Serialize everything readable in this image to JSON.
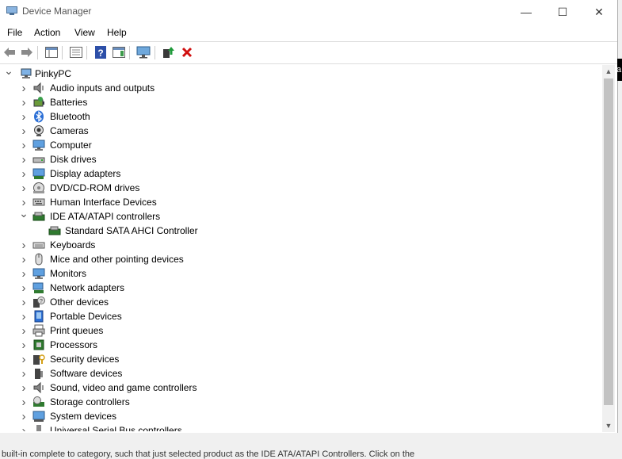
{
  "window": {
    "title": "Device Manager",
    "minimize_glyph": "—",
    "maximize_glyph": "☐",
    "close_glyph": "✕"
  },
  "menu": [
    "File",
    "Action",
    "View",
    "Help"
  ],
  "toolbar": [
    {
      "icon": "back-arrow-icon"
    },
    {
      "icon": "forward-arrow-icon"
    },
    {
      "icon": "show-hide-console-tree-icon"
    },
    {
      "icon": "properties-icon"
    },
    {
      "icon": "help-icon"
    },
    {
      "icon": "action-pane-icon"
    },
    {
      "icon": "scan-hardware-changes-icon"
    },
    {
      "icon": "update-driver-icon"
    },
    {
      "icon": "uninstall-device-icon"
    }
  ],
  "tree": {
    "root": {
      "label": "PinkyPC",
      "icon": "computer-icon",
      "expanded": true
    },
    "items": [
      {
        "label": "Audio inputs and outputs",
        "icon": "speaker-icon",
        "expanded": false
      },
      {
        "label": "Batteries",
        "icon": "battery-icon",
        "expanded": false
      },
      {
        "label": "Bluetooth",
        "icon": "bluetooth-icon",
        "expanded": false
      },
      {
        "label": "Cameras",
        "icon": "camera-icon",
        "expanded": false
      },
      {
        "label": "Computer",
        "icon": "monitor-icon",
        "expanded": false
      },
      {
        "label": "Disk drives",
        "icon": "disk-drive-icon",
        "expanded": false
      },
      {
        "label": "Display adapters",
        "icon": "display-adapter-icon",
        "expanded": false
      },
      {
        "label": "DVD/CD-ROM drives",
        "icon": "dvd-drive-icon",
        "expanded": false
      },
      {
        "label": "Human Interface Devices",
        "icon": "hid-icon",
        "expanded": false
      },
      {
        "label": "IDE ATA/ATAPI controllers",
        "icon": "ide-controller-icon",
        "expanded": true,
        "children": [
          {
            "label": "Standard SATA AHCI Controller",
            "icon": "ide-controller-icon"
          }
        ]
      },
      {
        "label": "Keyboards",
        "icon": "keyboard-icon",
        "expanded": false
      },
      {
        "label": "Mice and other pointing devices",
        "icon": "mouse-icon",
        "expanded": false
      },
      {
        "label": "Monitors",
        "icon": "monitor-icon",
        "expanded": false
      },
      {
        "label": "Network adapters",
        "icon": "network-adapter-icon",
        "expanded": false
      },
      {
        "label": "Other devices",
        "icon": "unknown-device-icon",
        "expanded": false
      },
      {
        "label": "Portable Devices",
        "icon": "portable-device-icon",
        "expanded": false
      },
      {
        "label": "Print queues",
        "icon": "printer-icon",
        "expanded": false
      },
      {
        "label": "Processors",
        "icon": "processor-icon",
        "expanded": false
      },
      {
        "label": "Security devices",
        "icon": "security-device-icon",
        "expanded": false
      },
      {
        "label": "Software devices",
        "icon": "software-device-icon",
        "expanded": false
      },
      {
        "label": "Sound, video and game controllers",
        "icon": "speaker-icon",
        "expanded": false
      },
      {
        "label": "Storage controllers",
        "icon": "storage-controller-icon",
        "expanded": false
      },
      {
        "label": "System devices",
        "icon": "system-devices-icon",
        "expanded": false
      },
      {
        "label": "Universal Serial Bus controllers",
        "icon": "usb-icon",
        "expanded": false
      }
    ]
  },
  "status": {
    "text": "built-in complete to category, such that just selected product as the IDE ATA/ATAPI Controllers. Click on the"
  },
  "background_window": {
    "fragment": "a"
  },
  "colors": {
    "accent_blue": "#2b6fd6",
    "uninstall_red": "#d01010",
    "update_green": "#1e9a3a"
  }
}
